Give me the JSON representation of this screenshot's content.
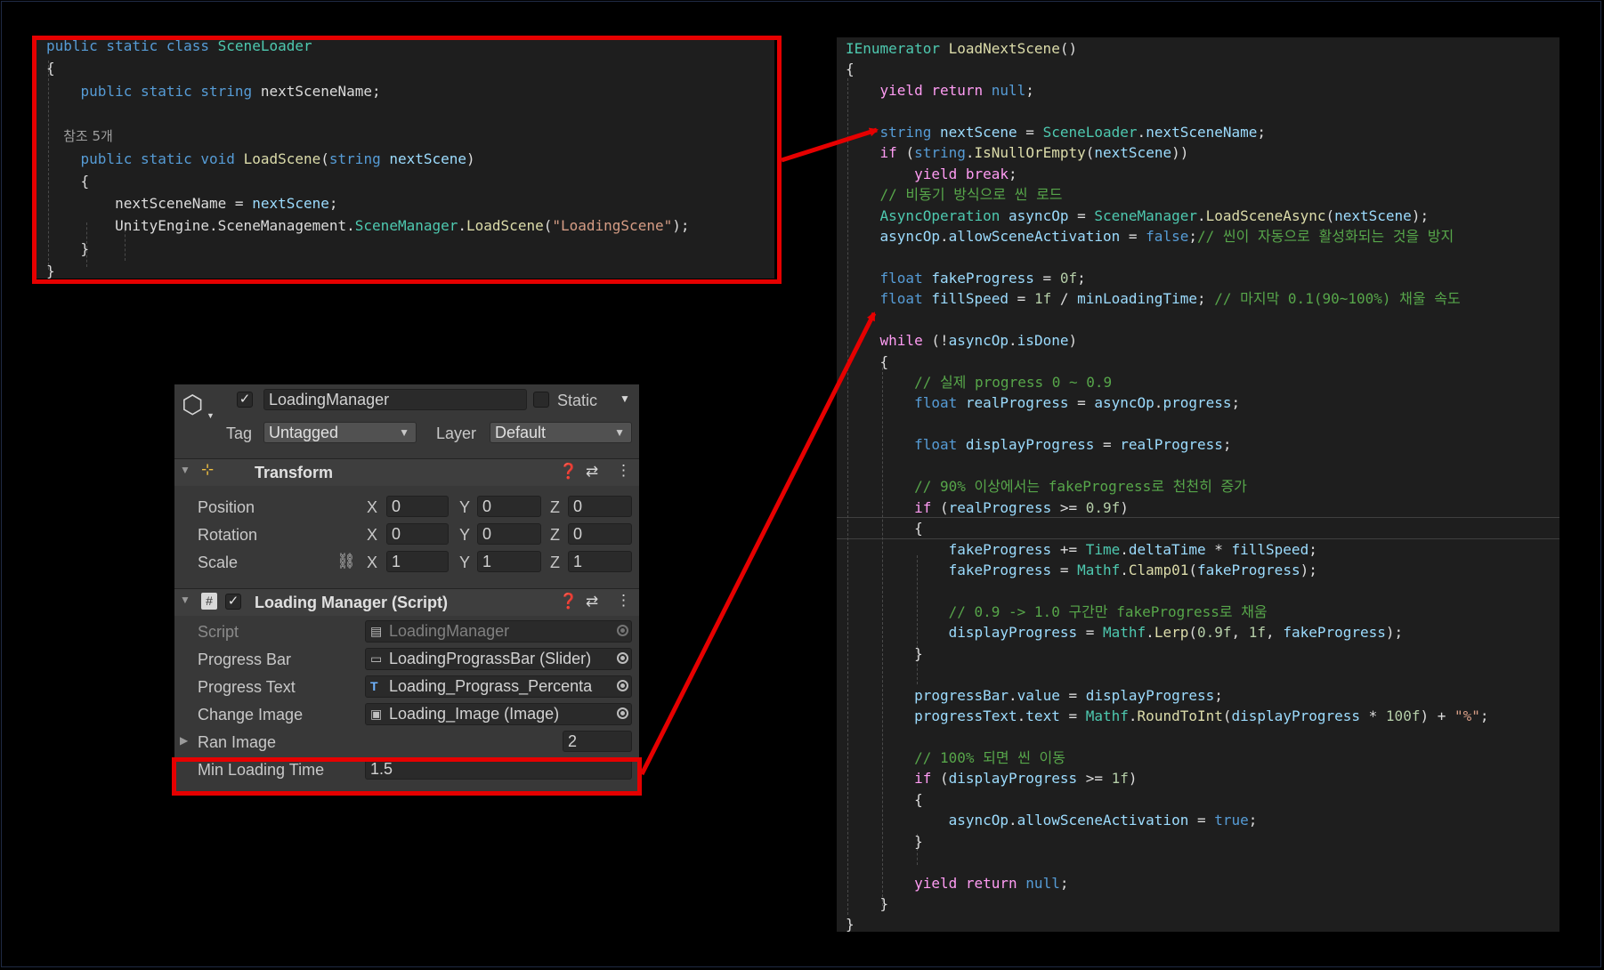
{
  "scene_loader_code": {
    "lines": [
      [
        [
          "k",
          "public static class "
        ],
        [
          "t",
          "SceneLoader"
        ]
      ],
      [
        [
          "p",
          "{"
        ]
      ],
      [
        [
          "p",
          "    "
        ],
        [
          "k",
          "public static string "
        ],
        [
          "p",
          "nextSceneName;"
        ]
      ],
      [],
      [
        [
          "ref",
          "    참조 5개"
        ]
      ],
      [
        [
          "p",
          "    "
        ],
        [
          "k",
          "public static void "
        ],
        [
          "m",
          "LoadScene"
        ],
        [
          "p",
          "("
        ],
        [
          "k",
          "string "
        ],
        [
          "v",
          "nextScene"
        ],
        [
          "p",
          ")"
        ]
      ],
      [
        [
          "p",
          "    {"
        ]
      ],
      [
        [
          "p",
          "        nextSceneName = "
        ],
        [
          "v",
          "nextScene"
        ],
        [
          "p",
          ";"
        ]
      ],
      [
        [
          "p",
          "        UnityEngine.SceneManagement."
        ],
        [
          "t",
          "SceneManager"
        ],
        [
          "p",
          "."
        ],
        [
          "m",
          "LoadScene"
        ],
        [
          "p",
          "("
        ],
        [
          "s",
          "\"LoadingScene\""
        ],
        [
          "p",
          ");"
        ]
      ],
      [
        [
          "p",
          "    }"
        ]
      ],
      [
        [
          "p",
          "}"
        ]
      ]
    ]
  },
  "load_next_scene_code": {
    "lines": [
      [
        [
          "t",
          "IEnumerator "
        ],
        [
          "m",
          "LoadNextScene"
        ],
        [
          "p",
          "()"
        ]
      ],
      [
        [
          "p",
          "{"
        ]
      ],
      [
        [
          "p",
          "    "
        ],
        [
          "kr",
          "yield return "
        ],
        [
          "k",
          "null"
        ],
        [
          "p",
          ";"
        ]
      ],
      [],
      [
        [
          "p",
          "    "
        ],
        [
          "k",
          "string "
        ],
        [
          "v",
          "nextScene"
        ],
        [
          "p",
          " = "
        ],
        [
          "t",
          "SceneLoader"
        ],
        [
          "p",
          "."
        ],
        [
          "v",
          "nextSceneName"
        ],
        [
          "p",
          ";"
        ]
      ],
      [
        [
          "p",
          "    "
        ],
        [
          "kr",
          "if "
        ],
        [
          "p",
          "("
        ],
        [
          "k",
          "string"
        ],
        [
          "p",
          "."
        ],
        [
          "m",
          "IsNullOrEmpty"
        ],
        [
          "p",
          "("
        ],
        [
          "v",
          "nextScene"
        ],
        [
          "p",
          "))"
        ]
      ],
      [
        [
          "p",
          "        "
        ],
        [
          "kr",
          "yield break"
        ],
        [
          "p",
          ";"
        ]
      ],
      [
        [
          "c",
          "    // 비동기 방식으로 씬 로드"
        ]
      ],
      [
        [
          "p",
          "    "
        ],
        [
          "t",
          "AsyncOperation "
        ],
        [
          "v",
          "asyncOp"
        ],
        [
          "p",
          " = "
        ],
        [
          "t",
          "SceneManager"
        ],
        [
          "p",
          "."
        ],
        [
          "m",
          "LoadSceneAsync"
        ],
        [
          "p",
          "("
        ],
        [
          "v",
          "nextScene"
        ],
        [
          "p",
          ");"
        ]
      ],
      [
        [
          "p",
          "    "
        ],
        [
          "v",
          "asyncOp"
        ],
        [
          "p",
          "."
        ],
        [
          "v",
          "allowSceneActivation"
        ],
        [
          "p",
          " = "
        ],
        [
          "k",
          "false"
        ],
        [
          "p",
          ";"
        ],
        [
          "c",
          "// 씬이 자동으로 활성화되는 것을 방지"
        ]
      ],
      [],
      [
        [
          "p",
          "    "
        ],
        [
          "k",
          "float "
        ],
        [
          "v",
          "fakeProgress"
        ],
        [
          "p",
          " = "
        ],
        [
          "n",
          "0f"
        ],
        [
          "p",
          ";"
        ]
      ],
      [
        [
          "p",
          "    "
        ],
        [
          "k",
          "float "
        ],
        [
          "v",
          "fillSpeed"
        ],
        [
          "p",
          " = "
        ],
        [
          "n",
          "1f"
        ],
        [
          "p",
          " / "
        ],
        [
          "v",
          "minLoadingTime"
        ],
        [
          "p",
          "; "
        ],
        [
          "c",
          "// 마지막 0.1(90~100%) 채울 속도"
        ]
      ],
      [],
      [
        [
          "p",
          "    "
        ],
        [
          "kr",
          "while "
        ],
        [
          "p",
          "(!"
        ],
        [
          "v",
          "asyncOp"
        ],
        [
          "p",
          "."
        ],
        [
          "v",
          "isDone"
        ],
        [
          "p",
          ")"
        ]
      ],
      [
        [
          "p",
          "    {"
        ]
      ],
      [
        [
          "c",
          "        // 실제 progress 0 ~ 0.9"
        ]
      ],
      [
        [
          "p",
          "        "
        ],
        [
          "k",
          "float "
        ],
        [
          "v",
          "realProgress"
        ],
        [
          "p",
          " = "
        ],
        [
          "v",
          "asyncOp"
        ],
        [
          "p",
          "."
        ],
        [
          "v",
          "progress"
        ],
        [
          "p",
          ";"
        ]
      ],
      [],
      [
        [
          "p",
          "        "
        ],
        [
          "k",
          "float "
        ],
        [
          "v",
          "displayProgress"
        ],
        [
          "p",
          " = "
        ],
        [
          "v",
          "realProgress"
        ],
        [
          "p",
          ";"
        ]
      ],
      [],
      [
        [
          "c",
          "        // 90% 이상에서는 fakeProgress로 천천히 증가"
        ]
      ],
      [
        [
          "p",
          "        "
        ],
        [
          "kr",
          "if "
        ],
        [
          "p",
          "("
        ],
        [
          "v",
          "realProgress"
        ],
        [
          "p",
          " >= "
        ],
        [
          "n",
          "0.9f"
        ],
        [
          "p",
          ")"
        ]
      ],
      [
        [
          "p",
          "        {"
        ]
      ],
      [
        [
          "p",
          "            "
        ],
        [
          "v",
          "fakeProgress"
        ],
        [
          "p",
          " += "
        ],
        [
          "t",
          "Time"
        ],
        [
          "p",
          "."
        ],
        [
          "v",
          "deltaTime"
        ],
        [
          "p",
          " * "
        ],
        [
          "v",
          "fillSpeed"
        ],
        [
          "p",
          ";"
        ]
      ],
      [
        [
          "p",
          "            "
        ],
        [
          "v",
          "fakeProgress"
        ],
        [
          "p",
          " = "
        ],
        [
          "t",
          "Mathf"
        ],
        [
          "p",
          "."
        ],
        [
          "m",
          "Clamp01"
        ],
        [
          "p",
          "("
        ],
        [
          "v",
          "fakeProgress"
        ],
        [
          "p",
          ");"
        ]
      ],
      [],
      [
        [
          "c",
          "            // 0.9 -> 1.0 구간만 fakeProgress로 채움"
        ]
      ],
      [
        [
          "p",
          "            "
        ],
        [
          "v",
          "displayProgress"
        ],
        [
          "p",
          " = "
        ],
        [
          "t",
          "Mathf"
        ],
        [
          "p",
          "."
        ],
        [
          "m",
          "Lerp"
        ],
        [
          "p",
          "("
        ],
        [
          "n",
          "0.9f"
        ],
        [
          "p",
          ", "
        ],
        [
          "n",
          "1f"
        ],
        [
          "p",
          ", "
        ],
        [
          "v",
          "fakeProgress"
        ],
        [
          "p",
          ");"
        ]
      ],
      [
        [
          "p",
          "        }"
        ]
      ],
      [],
      [
        [
          "p",
          "        "
        ],
        [
          "v",
          "progressBar"
        ],
        [
          "p",
          "."
        ],
        [
          "v",
          "value"
        ],
        [
          "p",
          " = "
        ],
        [
          "v",
          "displayProgress"
        ],
        [
          "p",
          ";"
        ]
      ],
      [
        [
          "p",
          "        "
        ],
        [
          "v",
          "progressText"
        ],
        [
          "p",
          "."
        ],
        [
          "v",
          "text"
        ],
        [
          "p",
          " = "
        ],
        [
          "t",
          "Mathf"
        ],
        [
          "p",
          "."
        ],
        [
          "m",
          "RoundToInt"
        ],
        [
          "p",
          "("
        ],
        [
          "v",
          "displayProgress"
        ],
        [
          "p",
          " * "
        ],
        [
          "n",
          "100f"
        ],
        [
          "p",
          ") + "
        ],
        [
          "s",
          "\"%\""
        ],
        [
          "p",
          ";"
        ]
      ],
      [],
      [
        [
          "c",
          "        // 100% 되면 씬 이동"
        ]
      ],
      [
        [
          "p",
          "        "
        ],
        [
          "kr",
          "if "
        ],
        [
          "p",
          "("
        ],
        [
          "v",
          "displayProgress"
        ],
        [
          "p",
          " >= "
        ],
        [
          "n",
          "1f"
        ],
        [
          "p",
          ")"
        ]
      ],
      [
        [
          "p",
          "        {"
        ]
      ],
      [
        [
          "p",
          "            "
        ],
        [
          "v",
          "asyncOp"
        ],
        [
          "p",
          "."
        ],
        [
          "v",
          "allowSceneActivation"
        ],
        [
          "p",
          " = "
        ],
        [
          "k",
          "true"
        ],
        [
          "p",
          ";"
        ]
      ],
      [
        [
          "p",
          "        }"
        ]
      ],
      [],
      [
        [
          "p",
          "        "
        ],
        [
          "kr",
          "yield return "
        ],
        [
          "k",
          "null"
        ],
        [
          "p",
          ";"
        ]
      ],
      [
        [
          "p",
          "    }"
        ]
      ],
      [
        [
          "p",
          "}"
        ]
      ]
    ]
  },
  "inspector": {
    "gameobject_name": "LoadingManager",
    "static_label": "Static",
    "tag_label": "Tag",
    "tag_value": "Untagged",
    "layer_label": "Layer",
    "layer_value": "Default",
    "transform": {
      "title": "Transform",
      "rows": [
        {
          "label": "Position",
          "x": "0",
          "y": "0",
          "z": "0"
        },
        {
          "label": "Rotation",
          "x": "0",
          "y": "0",
          "z": "0"
        },
        {
          "label": "Scale",
          "x": "1",
          "y": "1",
          "z": "1"
        }
      ],
      "axis_x": "X",
      "axis_y": "Y",
      "axis_z": "Z"
    },
    "script_component": {
      "title": "Loading Manager (Script)",
      "fields": [
        {
          "label": "Script",
          "value": "LoadingManager",
          "icon": "script-asset-icon"
        },
        {
          "label": "Progress Bar",
          "value": "LoadingPrograssBar (Slider)",
          "icon": "slider-icon"
        },
        {
          "label": "Progress Text",
          "value": "Loading_Prograss_Percenta",
          "icon": "text-icon"
        },
        {
          "label": "Change Image",
          "value": "Loading_Image (Image)",
          "icon": "image-icon"
        }
      ],
      "ran_image_label": "Ran Image",
      "ran_image_value": "2",
      "min_loading_time_label": "Min Loading Time",
      "min_loading_time_value": "1.5"
    }
  },
  "colors": {
    "highlight_red": "#e60000",
    "code_bg": "#1e1e1e",
    "inspector_bg": "#383838"
  }
}
